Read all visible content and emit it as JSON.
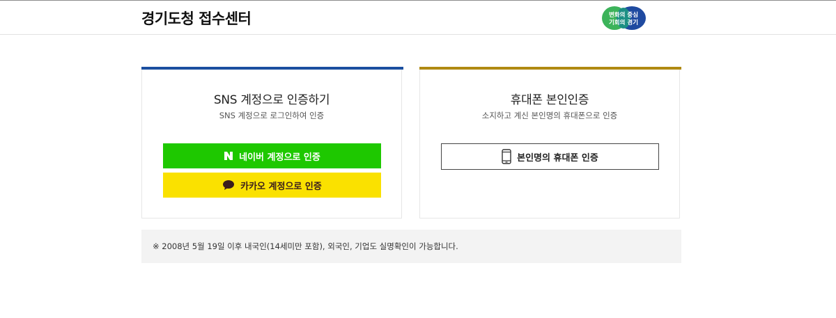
{
  "header": {
    "site_title": "경기도청 접수센터",
    "logo": {
      "line1": "변화의 중심",
      "line2": "기회의 경기",
      "colors": {
        "green": "#3cb35a",
        "blue": "#1f4aa0"
      }
    }
  },
  "cards": {
    "sns": {
      "accent": "#1b4fa0",
      "title": "SNS 계정으로 인증하기",
      "subtitle": "SNS 계정으로 로그인하여 인증",
      "naver_button": "네이버 계정으로 인증",
      "kakao_button": "카카오 계정으로 인증"
    },
    "phone": {
      "accent": "#b08a12",
      "title": "휴대폰 본인인증",
      "subtitle": "소지하고 계신 본인명의 휴대폰으로 인증",
      "phone_button": "본인명의 휴대폰 인증"
    }
  },
  "notice": {
    "text": "※ 2008년 5월 19일 이후 내국인(14세미만 포함), 외국인, 기업도 실명확인이 가능합니다."
  },
  "icons": {
    "naver": "naver-logo-icon",
    "kakao": "kakao-chat-icon",
    "phone": "mobile-phone-icon"
  }
}
